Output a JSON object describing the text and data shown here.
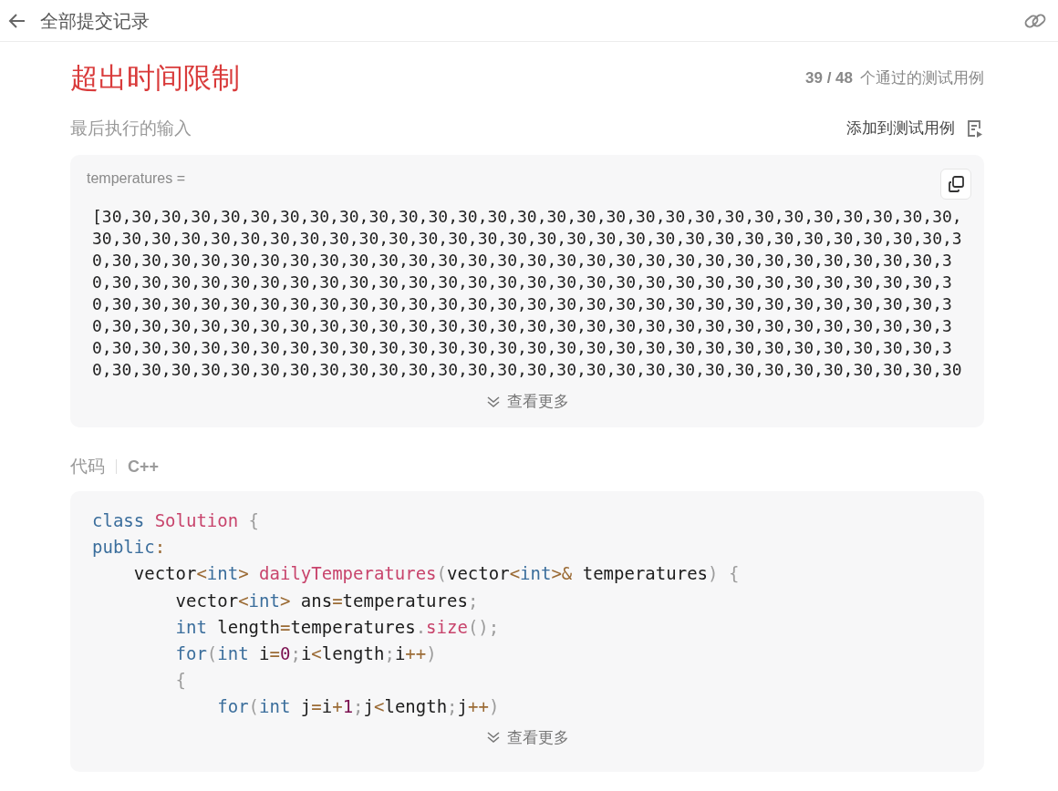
{
  "header": {
    "title": "全部提交记录"
  },
  "result": {
    "status": "超出时间限制",
    "passed_count": "39 / 48",
    "passed_label": "个通过的测试用例"
  },
  "last_input": {
    "heading": "最后执行的输入",
    "add_button": "添加到测试用例",
    "variable": "temperatures =",
    "lines": [
      "[30,30,30,30,30,30,30,30,30,30,30,30,30,30,30,30,30,30,30,30,30,30,30,30,30,30,30,30,30,",
      "30,30,30,30,30,30,30,30,30,30,30,30,30,30,30,30,30,30,30,30,30,30,30,30,30,30,30,30,30,3",
      "0,30,30,30,30,30,30,30,30,30,30,30,30,30,30,30,30,30,30,30,30,30,30,30,30,30,30,30,30,3",
      "0,30,30,30,30,30,30,30,30,30,30,30,30,30,30,30,30,30,30,30,30,30,30,30,30,30,30,30,30,3",
      "0,30,30,30,30,30,30,30,30,30,30,30,30,30,30,30,30,30,30,30,30,30,30,30,30,30,30,30,30,3",
      "0,30,30,30,30,30,30,30,30,30,30,30,30,30,30,30,30,30,30,30,30,30,30,30,30,30,30,30,30,3",
      "0,30,30,30,30,30,30,30,30,30,30,30,30,30,30,30,30,30,30,30,30,30,30,30,30,30,30,30,30,3",
      "0,30,30,30,30,30,30,30,30,30,30,30,30,30,30,30,30,30,30,30,30,30,30,30,30,30,30,30,30,30"
    ],
    "more": "查看更多"
  },
  "code": {
    "heading": "代码",
    "language": "C++",
    "lines": [
      [
        {
          "kind": "kw",
          "text": "class"
        },
        {
          "kind": "name",
          "text": " Solution"
        },
        {
          "kind": "punct",
          "text": " {"
        }
      ],
      [
        {
          "kind": "kw",
          "text": "public"
        },
        {
          "kind": "op",
          "text": ":"
        }
      ],
      [
        {
          "kind": "plain",
          "text": "    vector"
        },
        {
          "kind": "op",
          "text": "<"
        },
        {
          "kind": "kw",
          "text": "int"
        },
        {
          "kind": "op",
          "text": ">"
        },
        {
          "kind": "name",
          "text": " dailyTemperatures"
        },
        {
          "kind": "punct",
          "text": "("
        },
        {
          "kind": "plain",
          "text": "vector"
        },
        {
          "kind": "op",
          "text": "<"
        },
        {
          "kind": "kw",
          "text": "int"
        },
        {
          "kind": "op",
          "text": ">&"
        },
        {
          "kind": "plain",
          "text": " temperatures"
        },
        {
          "kind": "punct",
          "text": ")"
        },
        {
          "kind": "punct",
          "text": " {"
        }
      ],
      [
        {
          "kind": "plain",
          "text": "        vector"
        },
        {
          "kind": "op",
          "text": "<"
        },
        {
          "kind": "kw",
          "text": "int"
        },
        {
          "kind": "op",
          "text": ">"
        },
        {
          "kind": "plain",
          "text": " ans"
        },
        {
          "kind": "op",
          "text": "="
        },
        {
          "kind": "plain",
          "text": "temperatures"
        },
        {
          "kind": "punct",
          "text": ";"
        }
      ],
      [
        {
          "kind": "kw",
          "text": "        int"
        },
        {
          "kind": "plain",
          "text": " length"
        },
        {
          "kind": "op",
          "text": "="
        },
        {
          "kind": "plain",
          "text": "temperatures"
        },
        {
          "kind": "punct",
          "text": "."
        },
        {
          "kind": "name",
          "text": "size"
        },
        {
          "kind": "punct",
          "text": "();"
        }
      ],
      [
        {
          "kind": "kw",
          "text": "        for"
        },
        {
          "kind": "punct",
          "text": "("
        },
        {
          "kind": "kw",
          "text": "int"
        },
        {
          "kind": "plain",
          "text": " i"
        },
        {
          "kind": "op",
          "text": "="
        },
        {
          "kind": "num",
          "text": "0"
        },
        {
          "kind": "punct",
          "text": ";"
        },
        {
          "kind": "plain",
          "text": "i"
        },
        {
          "kind": "op",
          "text": "<"
        },
        {
          "kind": "plain",
          "text": "length"
        },
        {
          "kind": "punct",
          "text": ";"
        },
        {
          "kind": "plain",
          "text": "i"
        },
        {
          "kind": "op",
          "text": "++"
        },
        {
          "kind": "punct",
          "text": ")"
        }
      ],
      [
        {
          "kind": "punct",
          "text": "        {"
        }
      ],
      [
        {
          "kind": "kw",
          "text": "            for"
        },
        {
          "kind": "punct",
          "text": "("
        },
        {
          "kind": "kw",
          "text": "int"
        },
        {
          "kind": "plain",
          "text": " j"
        },
        {
          "kind": "op",
          "text": "="
        },
        {
          "kind": "plain",
          "text": "i"
        },
        {
          "kind": "op",
          "text": "+"
        },
        {
          "kind": "num",
          "text": "1"
        },
        {
          "kind": "punct",
          "text": ";"
        },
        {
          "kind": "plain",
          "text": "j"
        },
        {
          "kind": "op",
          "text": "<"
        },
        {
          "kind": "plain",
          "text": "length"
        },
        {
          "kind": "punct",
          "text": ";"
        },
        {
          "kind": "plain",
          "text": "j"
        },
        {
          "kind": "op",
          "text": "++"
        },
        {
          "kind": "punct",
          "text": ")"
        }
      ]
    ],
    "more": "查看更多"
  }
}
